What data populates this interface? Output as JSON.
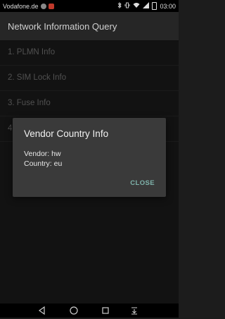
{
  "status_bar": {
    "carrier": "Vodafone.de",
    "time": "03:00",
    "icons": [
      "notification-dot-icon",
      "app-notification-icon",
      "bluetooth-icon",
      "vibrate-icon",
      "wifi-icon",
      "signal-icon",
      "battery-icon"
    ]
  },
  "toolbar": {
    "title": "Network Information Query"
  },
  "menu": {
    "items": [
      {
        "label": "1. PLMN Info"
      },
      {
        "label": "2. SIM Lock Info"
      },
      {
        "label": "3. Fuse Info"
      },
      {
        "label": "4."
      }
    ]
  },
  "dialog": {
    "title": "Vendor Country Info",
    "vendor_line": "Vendor: hw",
    "country_line": "Country: eu",
    "close_label": "CLOSE"
  },
  "nav_bar": {
    "icons": [
      "back-icon",
      "home-icon",
      "recent-apps-icon",
      "notification-shade-icon"
    ]
  },
  "colors": {
    "background": "#1c1c1c",
    "toolbar": "#262626",
    "dialog": "#3a3a3a",
    "accent": "#7fb3ab"
  }
}
